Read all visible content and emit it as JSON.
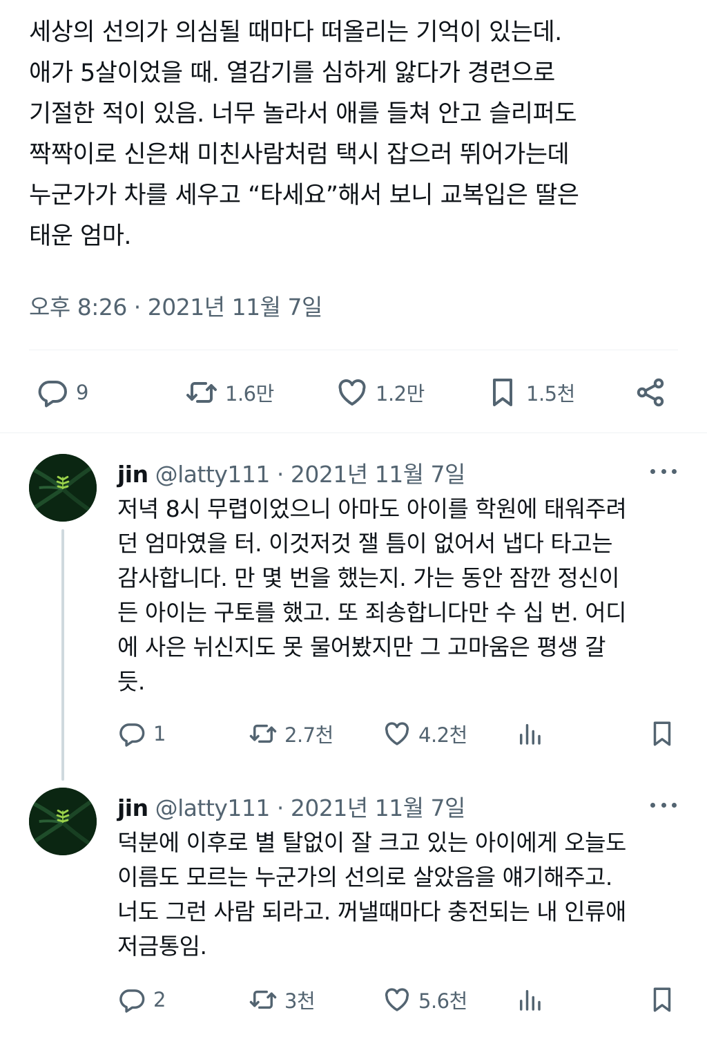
{
  "main_tweet": {
    "lines": [
      "세상의 선의가 의심될 때마다 떠올리는 기억이 있는데.",
      "애가 5살이었을 때. 열감기를 심하게 앓다가 경련으로",
      "기절한 적이 있음. 너무 놀라서 애를 들쳐 안고 슬리퍼도",
      "짝짝이로 신은채 미친사람처럼 택시 잡으러 뛰어가는데",
      "누군가가 차를 세우고 “타세요”해서 보니 교복입은 딸은",
      "태운 엄마."
    ],
    "timestamp": "오후 8:26 · 2021년 11월 7일",
    "stats": {
      "replies": "9",
      "retweets": "1.6만",
      "likes": "1.2만",
      "bookmarks": "1.5천"
    }
  },
  "replies": [
    {
      "name": "jin",
      "meta": "@latty111 · 2021년 11월 7일",
      "lines": [
        "저녁 8시 무렵이었으니 아마도 아이를 학원에 태워주려",
        "던 엄마였을 터. 이것저것 잴 틈이 없어서 냅다 타고는",
        "감사합니다. 만 몇 번을 했는지. 가는 동안 잠깐 정신이",
        "든 아이는 구토를 했고. 또 죄송합니다만 수 십 번. 어디",
        "에 사은 뉘신지도 못 물어봤지만 그 고마움은 평생 갈",
        "듯."
      ],
      "stats": {
        "replies": "1",
        "retweets": "2.7천",
        "likes": "4.2천"
      }
    },
    {
      "name": "jin",
      "meta": "@latty111 · 2021년 11월 7일",
      "lines": [
        "덕분에 이후로 별 탈없이 잘 크고 있는 아이에게 오늘도",
        "이름도 모르는 누군가의 선의로 살았음을 얘기해주고.",
        "너도 그런 사람 되라고. 꺼낼때마다 충전되는 내 인류애",
        "저금통임."
      ],
      "stats": {
        "replies": "2",
        "retweets": "3천",
        "likes": "5.6천"
      }
    }
  ]
}
